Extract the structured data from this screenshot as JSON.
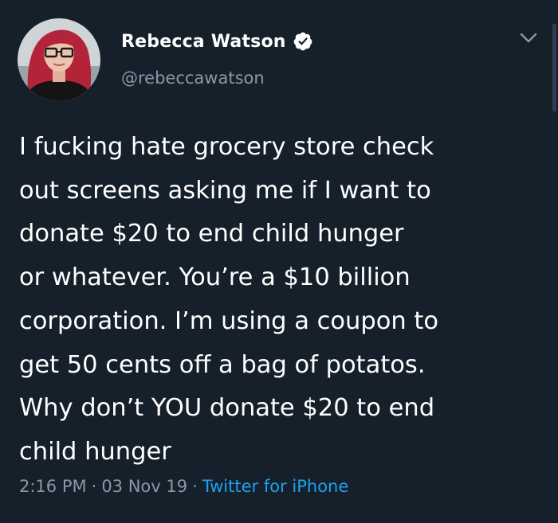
{
  "author": {
    "display_name": "Rebecca Watson",
    "username": "@rebeccawatson",
    "verified": true,
    "verified_icon": "verified-badge-icon"
  },
  "tweet": {
    "text_lines": [
      "I fucking hate grocery store check",
      "out screens asking me if I want to",
      "donate $20 to end child hunger",
      "or whatever. You’re a $10 billion",
      "corporation. I’m using a coupon to",
      "get 50 cents off a bag of potatos.",
      "Why don’t YOU donate $20 to end",
      "child hunger"
    ]
  },
  "meta": {
    "time": "2:16 PM",
    "separator": "·",
    "date": "03 Nov 19",
    "source": "Twitter for iPhone"
  },
  "menu": {
    "icon": "chevron-down-icon"
  },
  "colors": {
    "background": "#15202b",
    "primary_text": "#ffffff",
    "secondary_text": "#8899a6",
    "link": "#1da1f2"
  }
}
